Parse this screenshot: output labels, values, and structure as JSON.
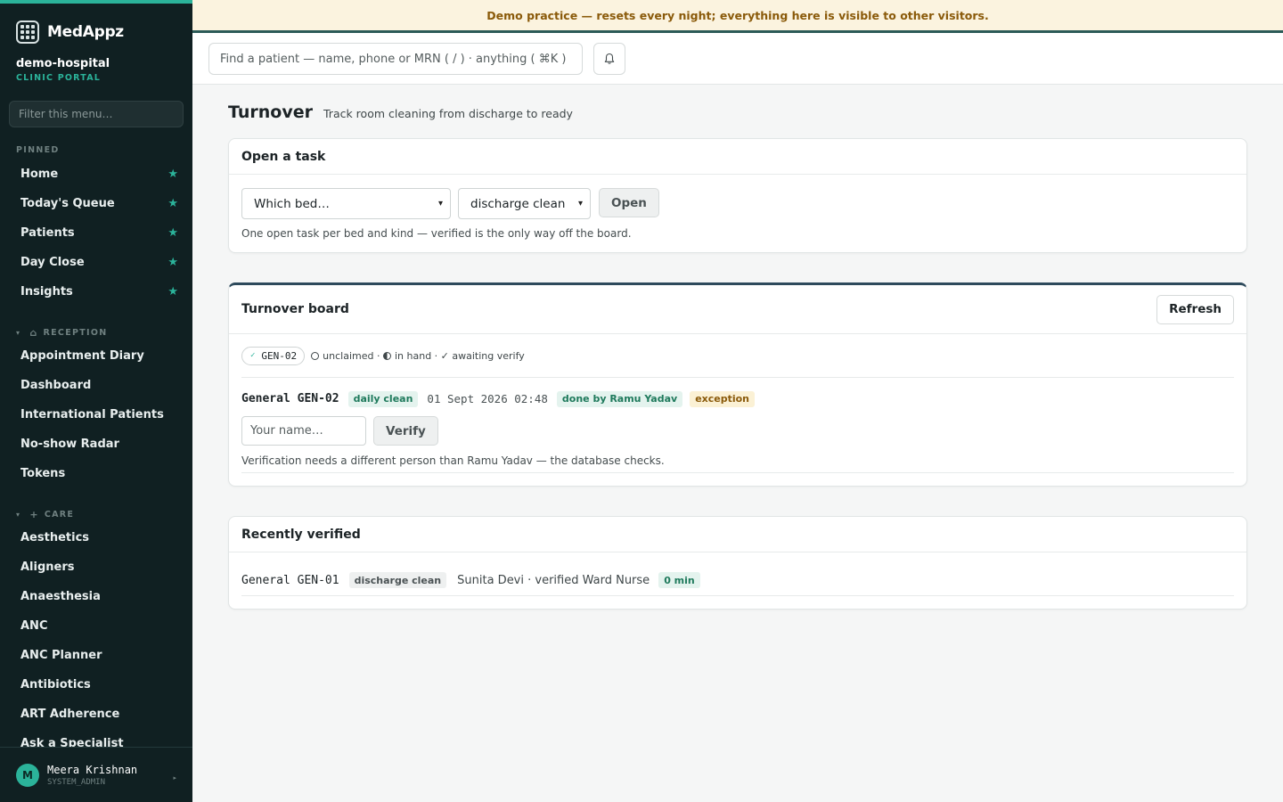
{
  "brand": {
    "name": "MedAppz"
  },
  "hospital": {
    "name": "demo-hospital",
    "portal": "CLINIC PORTAL"
  },
  "sidebar": {
    "filter_placeholder": "Filter this menu…",
    "pinned_label": "PINNED",
    "pinned": [
      "Home",
      "Today's Queue",
      "Patients",
      "Day Close",
      "Insights"
    ],
    "reception_label": "RECEPTION",
    "reception": [
      "Appointment Diary",
      "Dashboard",
      "International Patients",
      "No-show Radar",
      "Tokens"
    ],
    "care_label": "CARE",
    "care": [
      "Aesthetics",
      "Aligners",
      "Anaesthesia",
      "ANC",
      "ANC Planner",
      "Antibiotics",
      "ART Adherence",
      "Ask a Specialist"
    ]
  },
  "user": {
    "initial": "M",
    "name": "Meera Krishnan",
    "role": "SYSTEM_ADMIN"
  },
  "banner": {
    "text": "Demo practice — resets every night; everything here is visible to other visitors."
  },
  "topbar": {
    "search_placeholder": "Find a patient — name, phone or MRN ( / ) · anything ( ⌘K )"
  },
  "page": {
    "title": "Turnover",
    "subtitle": "Track room cleaning from discharge to ready"
  },
  "open_task": {
    "title": "Open a task",
    "bed_select": "Which bed…",
    "kind_select": "discharge clean",
    "open_label": "Open",
    "hint": "One open task per bed and kind — verified is the only way off the board."
  },
  "board": {
    "title": "Turnover board",
    "refresh_label": "Refresh",
    "chip": "GEN-02",
    "legend_unclaimed": "unclaimed ·",
    "legend_in_hand": "in hand ·",
    "legend_awaiting": "✓ awaiting verify",
    "task": {
      "bed": "General GEN-02",
      "kind": "daily clean",
      "time": "01 Sept 2026 02:48",
      "done_by": "done by Ramu Yadav",
      "flag": "exception",
      "name_placeholder": "Your name…",
      "verify_label": "Verify",
      "note": "Verification needs a different person than Ramu Yadav — the database checks."
    }
  },
  "recent": {
    "title": "Recently verified",
    "row": {
      "bed": "General GEN-01",
      "kind": "discharge clean",
      "text": "Sunita Devi · verified Ward Nurse",
      "duration": "0 min"
    }
  }
}
